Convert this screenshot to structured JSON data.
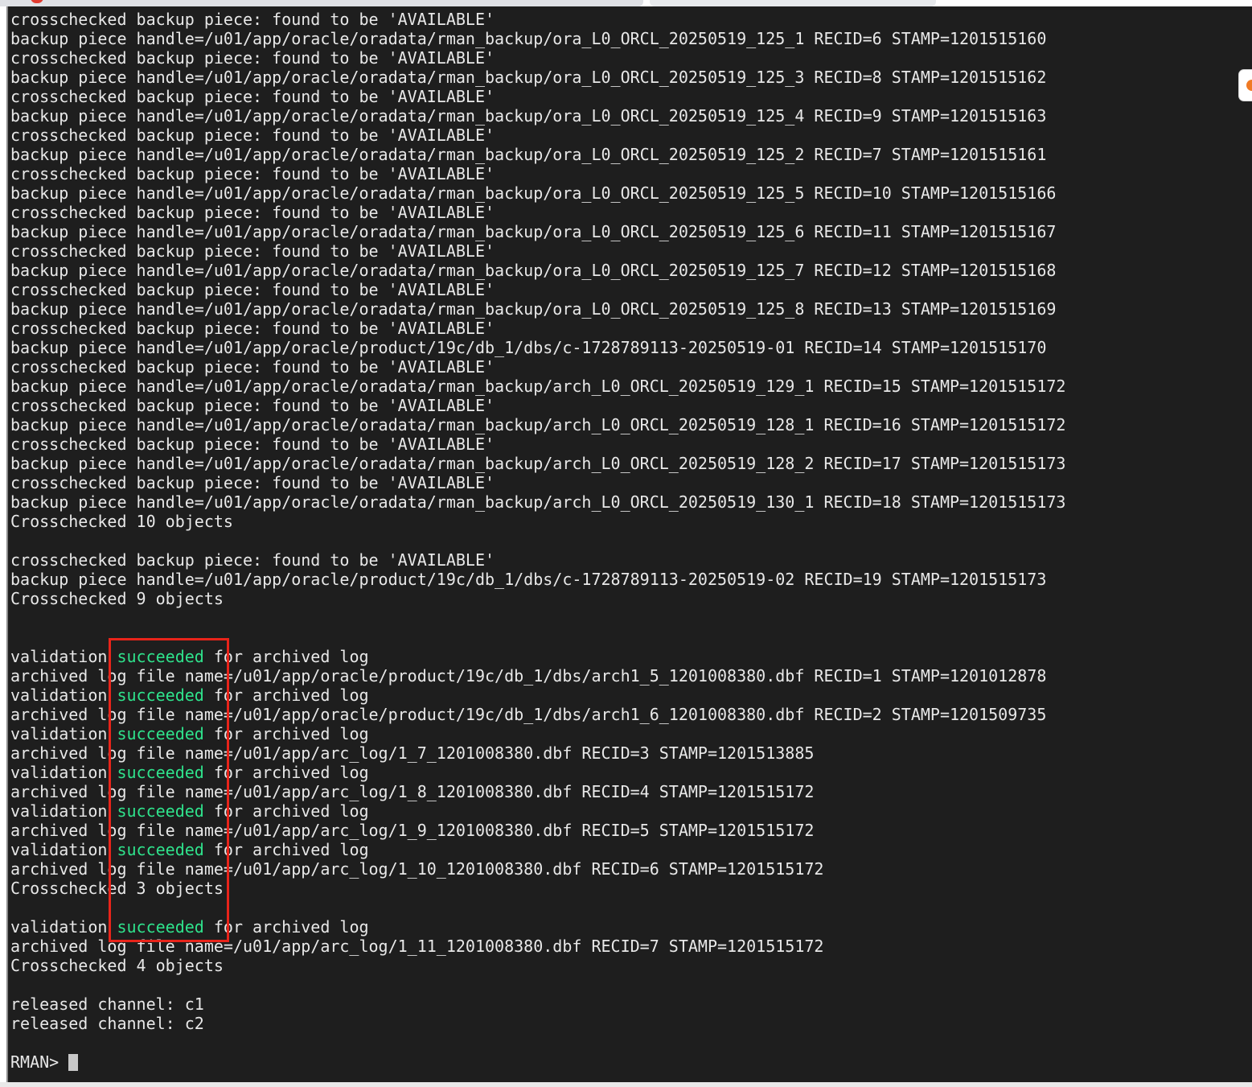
{
  "terminal": {
    "lines": [
      {
        "text": "crosschecked backup piece: found to be 'AVAILABLE'"
      },
      {
        "text": "backup piece handle=/u01/app/oracle/oradata/rman_backup/ora_L0_ORCL_20250519_125_1 RECID=6 STAMP=1201515160"
      },
      {
        "text": "crosschecked backup piece: found to be 'AVAILABLE'"
      },
      {
        "text": "backup piece handle=/u01/app/oracle/oradata/rman_backup/ora_L0_ORCL_20250519_125_3 RECID=8 STAMP=1201515162"
      },
      {
        "text": "crosschecked backup piece: found to be 'AVAILABLE'"
      },
      {
        "text": "backup piece handle=/u01/app/oracle/oradata/rman_backup/ora_L0_ORCL_20250519_125_4 RECID=9 STAMP=1201515163"
      },
      {
        "text": "crosschecked backup piece: found to be 'AVAILABLE'"
      },
      {
        "text": "backup piece handle=/u01/app/oracle/oradata/rman_backup/ora_L0_ORCL_20250519_125_2 RECID=7 STAMP=1201515161"
      },
      {
        "text": "crosschecked backup piece: found to be 'AVAILABLE'"
      },
      {
        "text": "backup piece handle=/u01/app/oracle/oradata/rman_backup/ora_L0_ORCL_20250519_125_5 RECID=10 STAMP=1201515166"
      },
      {
        "text": "crosschecked backup piece: found to be 'AVAILABLE'"
      },
      {
        "text": "backup piece handle=/u01/app/oracle/oradata/rman_backup/ora_L0_ORCL_20250519_125_6 RECID=11 STAMP=1201515167"
      },
      {
        "text": "crosschecked backup piece: found to be 'AVAILABLE'"
      },
      {
        "text": "backup piece handle=/u01/app/oracle/oradata/rman_backup/ora_L0_ORCL_20250519_125_7 RECID=12 STAMP=1201515168"
      },
      {
        "text": "crosschecked backup piece: found to be 'AVAILABLE'"
      },
      {
        "text": "backup piece handle=/u01/app/oracle/oradata/rman_backup/ora_L0_ORCL_20250519_125_8 RECID=13 STAMP=1201515169"
      },
      {
        "text": "crosschecked backup piece: found to be 'AVAILABLE'"
      },
      {
        "text": "backup piece handle=/u01/app/oracle/product/19c/db_1/dbs/c-1728789113-20250519-01 RECID=14 STAMP=1201515170"
      },
      {
        "text": "crosschecked backup piece: found to be 'AVAILABLE'"
      },
      {
        "text": "backup piece handle=/u01/app/oracle/oradata/rman_backup/arch_L0_ORCL_20250519_129_1 RECID=15 STAMP=1201515172"
      },
      {
        "text": "crosschecked backup piece: found to be 'AVAILABLE'"
      },
      {
        "text": "backup piece handle=/u01/app/oracle/oradata/rman_backup/arch_L0_ORCL_20250519_128_1 RECID=16 STAMP=1201515172"
      },
      {
        "text": "crosschecked backup piece: found to be 'AVAILABLE'"
      },
      {
        "text": "backup piece handle=/u01/app/oracle/oradata/rman_backup/arch_L0_ORCL_20250519_128_2 RECID=17 STAMP=1201515173"
      },
      {
        "text": "crosschecked backup piece: found to be 'AVAILABLE'"
      },
      {
        "text": "backup piece handle=/u01/app/oracle/oradata/rman_backup/arch_L0_ORCL_20250519_130_1 RECID=18 STAMP=1201515173"
      },
      {
        "text": "Crosschecked 10 objects"
      },
      {
        "text": ""
      },
      {
        "text": "crosschecked backup piece: found to be 'AVAILABLE'"
      },
      {
        "text": "backup piece handle=/u01/app/oracle/product/19c/db_1/dbs/c-1728789113-20250519-02 RECID=19 STAMP=1201515173"
      },
      {
        "text": "Crosschecked 9 objects"
      },
      {
        "text": ""
      },
      {
        "text": ""
      },
      {
        "pre": "validation ",
        "ok": "succeeded",
        "post": " for archived log"
      },
      {
        "text": "archived log file name=/u01/app/oracle/product/19c/db_1/dbs/arch1_5_1201008380.dbf RECID=1 STAMP=1201012878"
      },
      {
        "pre": "validation ",
        "ok": "succeeded",
        "post": " for archived log"
      },
      {
        "text": "archived log file name=/u01/app/oracle/product/19c/db_1/dbs/arch1_6_1201008380.dbf RECID=2 STAMP=1201509735"
      },
      {
        "pre": "validation ",
        "ok": "succeeded",
        "post": " for archived log"
      },
      {
        "text": "archived log file name=/u01/app/arc_log/1_7_1201008380.dbf RECID=3 STAMP=1201513885"
      },
      {
        "pre": "validation ",
        "ok": "succeeded",
        "post": " for archived log"
      },
      {
        "text": "archived log file name=/u01/app/arc_log/1_8_1201008380.dbf RECID=4 STAMP=1201515172"
      },
      {
        "pre": "validation ",
        "ok": "succeeded",
        "post": " for archived log"
      },
      {
        "text": "archived log file name=/u01/app/arc_log/1_9_1201008380.dbf RECID=5 STAMP=1201515172"
      },
      {
        "pre": "validation ",
        "ok": "succeeded",
        "post": " for archived log"
      },
      {
        "text": "archived log file name=/u01/app/arc_log/1_10_1201008380.dbf RECID=6 STAMP=1201515172"
      },
      {
        "text": "Crosschecked 3 objects"
      },
      {
        "text": ""
      },
      {
        "pre": "validation ",
        "ok": "succeeded",
        "post": " for archived log"
      },
      {
        "text": "archived log file name=/u01/app/arc_log/1_11_1201008380.dbf RECID=7 STAMP=1201515172"
      },
      {
        "text": "Crosschecked 4 objects"
      },
      {
        "text": ""
      },
      {
        "text": "released channel: c1"
      },
      {
        "text": "released channel: c2"
      },
      {
        "text": ""
      }
    ],
    "prompt": "RMAN> ",
    "colors": {
      "background": "#1e1e1e",
      "text": "#e8e8e8",
      "success": "#2fe38c",
      "highlight_box": "#e8241a",
      "cursor": "#c8c8c8"
    }
  }
}
